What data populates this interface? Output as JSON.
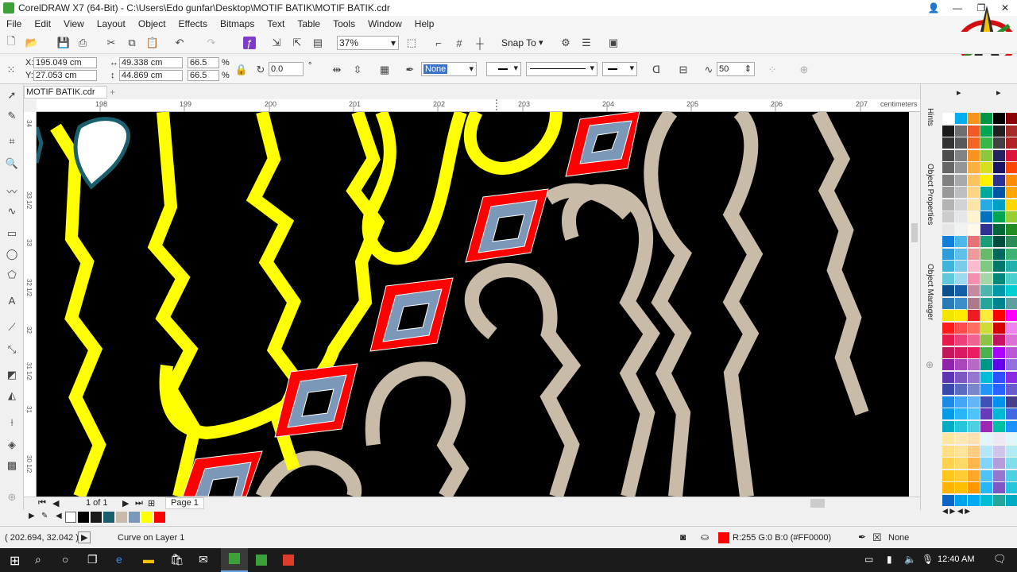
{
  "window": {
    "title": "CorelDRAW X7 (64-Bit) - C:\\Users\\Edo gunfar\\Desktop\\MOTIF BATIK\\MOTIF BATIK.cdr"
  },
  "menu": [
    "File",
    "Edit",
    "View",
    "Layout",
    "Object",
    "Effects",
    "Bitmaps",
    "Text",
    "Table",
    "Tools",
    "Window",
    "Help"
  ],
  "toolbar": {
    "zoom": "37%",
    "snap_to": "Snap To"
  },
  "property_bar": {
    "x_label": "X:",
    "x_value": "195.049 cm",
    "y_label": "Y:",
    "y_value": "27.053 cm",
    "width": "49.338 cm",
    "height": "44.869 cm",
    "scale_x": "66.5",
    "scale_y": "66.5",
    "percent": "%",
    "rotation": "0.0",
    "outline": "None",
    "smoothing": "50"
  },
  "document_tab": "MOTIF BATIK.cdr",
  "ruler": {
    "ticks": [
      "198",
      "199",
      "200",
      "201",
      "202",
      "203",
      "204",
      "205",
      "206",
      "207"
    ],
    "units": "centimeters",
    "vticks": [
      "34",
      "33 1/2",
      "33",
      "32 1/2",
      "32",
      "31 1/2",
      "31",
      "30 1/2"
    ]
  },
  "page_nav": {
    "position": "1 of 1",
    "page_label": "Page 1"
  },
  "dockers": [
    "Hints",
    "Object Properties",
    "Object Manager"
  ],
  "status": {
    "coords": "( 202.694, 32.042 )",
    "object_info": "Curve on Layer 1",
    "fill_info": "R:255 G:0 B:0 (#FF0000)",
    "outline_info": "None"
  },
  "taskbar": {
    "time": "12:40 AM"
  },
  "colors": {
    "yellow": "#ffff00",
    "red": "#ff0000",
    "beige": "#c8bba8",
    "blue": "#7c98b8",
    "teal": "#1a5f6e"
  }
}
